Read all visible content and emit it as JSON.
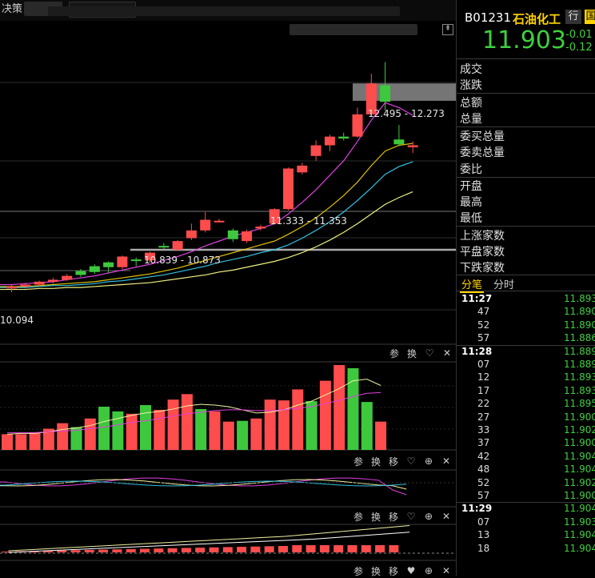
{
  "top": {
    "left_tab": "决策",
    "pin_icon": "pin-icon"
  },
  "main_chart": {
    "annotations": [
      {
        "text": "12.495 - 12.273"
      },
      {
        "text": "11.333 - 11.353"
      },
      {
        "text": "10.839 - 10.873"
      }
    ],
    "low_label": "10.094",
    "candles": [
      {
        "o": 10.18,
        "h": 10.22,
        "l": 10.14,
        "c": 10.2,
        "dir": "up"
      },
      {
        "o": 10.2,
        "h": 10.24,
        "l": 10.18,
        "c": 10.22,
        "dir": "up"
      },
      {
        "o": 10.22,
        "h": 10.26,
        "l": 10.2,
        "c": 10.25,
        "dir": "up"
      },
      {
        "o": 10.25,
        "h": 10.29,
        "l": 10.23,
        "c": 10.27,
        "dir": "up"
      },
      {
        "o": 10.27,
        "h": 10.33,
        "l": 10.26,
        "c": 10.31,
        "dir": "up"
      },
      {
        "o": 10.36,
        "h": 10.38,
        "l": 10.3,
        "c": 10.32,
        "dir": "down"
      },
      {
        "o": 10.41,
        "h": 10.43,
        "l": 10.33,
        "c": 10.35,
        "dir": "down"
      },
      {
        "o": 10.45,
        "h": 10.46,
        "l": 10.34,
        "c": 10.4,
        "dir": "down"
      },
      {
        "o": 10.4,
        "h": 10.52,
        "l": 10.38,
        "c": 10.51,
        "dir": "up"
      },
      {
        "o": 10.47,
        "h": 10.5,
        "l": 10.41,
        "c": 10.48,
        "dir": "down"
      },
      {
        "o": 10.47,
        "h": 10.56,
        "l": 10.45,
        "c": 10.55,
        "dir": "up"
      },
      {
        "o": 10.62,
        "h": 10.65,
        "l": 10.58,
        "c": 10.62,
        "dir": "down"
      },
      {
        "o": 10.58,
        "h": 10.68,
        "l": 10.57,
        "c": 10.67,
        "dir": "up"
      },
      {
        "o": 10.7,
        "h": 10.85,
        "l": 10.68,
        "c": 10.78,
        "dir": "up"
      },
      {
        "o": 10.78,
        "h": 10.97,
        "l": 10.76,
        "c": 10.89,
        "dir": "up"
      },
      {
        "o": 10.88,
        "h": 10.9,
        "l": 10.86,
        "c": 10.88,
        "dir": "up"
      },
      {
        "o": 10.78,
        "h": 10.8,
        "l": 10.66,
        "c": 10.69,
        "dir": "down"
      },
      {
        "o": 10.67,
        "h": 10.79,
        "l": 10.65,
        "c": 10.77,
        "dir": "up"
      },
      {
        "o": 10.8,
        "h": 10.84,
        "l": 10.78,
        "c": 10.82,
        "dir": "up"
      },
      {
        "o": 10.85,
        "h": 11.01,
        "l": 10.84,
        "c": 11.0,
        "dir": "up"
      },
      {
        "o": 11.0,
        "h": 11.43,
        "l": 10.99,
        "c": 11.42,
        "dir": "up"
      },
      {
        "o": 11.38,
        "h": 11.48,
        "l": 11.36,
        "c": 11.45,
        "dir": "up"
      },
      {
        "o": 11.55,
        "h": 11.71,
        "l": 11.5,
        "c": 11.66,
        "dir": "up"
      },
      {
        "o": 11.66,
        "h": 11.77,
        "l": 11.6,
        "c": 11.75,
        "dir": "up"
      },
      {
        "o": 11.75,
        "h": 11.79,
        "l": 11.71,
        "c": 11.73,
        "dir": "down"
      },
      {
        "o": 11.75,
        "h": 12.05,
        "l": 11.74,
        "c": 11.98,
        "dir": "up"
      },
      {
        "o": 11.98,
        "h": 12.4,
        "l": 11.96,
        "c": 12.3,
        "dir": "up"
      },
      {
        "o": 12.28,
        "h": 12.52,
        "l": 12.02,
        "c": 12.11,
        "dir": "down"
      },
      {
        "o": 11.72,
        "h": 11.87,
        "l": 11.65,
        "c": 11.67,
        "dir": "down"
      },
      {
        "o": 11.66,
        "h": 11.7,
        "l": 11.58,
        "c": 11.64,
        "dir": "up"
      }
    ],
    "ma_lines": [
      {
        "color": "#e040e0",
        "values": [
          10.22,
          10.23,
          10.24,
          10.25,
          10.27,
          10.29,
          10.31,
          10.34,
          10.37,
          10.4,
          10.43,
          10.47,
          10.51,
          10.56,
          10.62,
          10.67,
          10.72,
          10.76,
          10.8,
          10.85,
          10.95,
          11.07,
          11.2,
          11.35,
          11.5,
          11.7,
          11.92,
          12.1,
          12.05,
          11.97
        ]
      },
      {
        "color": "#e0c000",
        "values": [
          10.2,
          10.2,
          10.21,
          10.22,
          10.23,
          10.24,
          10.25,
          10.27,
          10.29,
          10.31,
          10.33,
          10.36,
          10.39,
          10.43,
          10.47,
          10.51,
          10.55,
          10.59,
          10.63,
          10.67,
          10.74,
          10.82,
          10.91,
          11.02,
          11.14,
          11.28,
          11.45,
          11.6,
          11.66,
          11.68
        ]
      },
      {
        "color": "#30c0e0",
        "values": [
          10.19,
          10.19,
          10.2,
          10.21,
          10.21,
          10.22,
          10.23,
          10.25,
          10.26,
          10.28,
          10.3,
          10.32,
          10.35,
          10.38,
          10.41,
          10.45,
          10.48,
          10.51,
          10.55,
          10.58,
          10.63,
          10.7,
          10.78,
          10.87,
          10.97,
          11.09,
          11.22,
          11.36,
          11.44,
          11.49
        ]
      },
      {
        "color": "#f0f080",
        "values": [
          10.17,
          10.17,
          10.18,
          10.18,
          10.19,
          10.19,
          10.2,
          10.21,
          10.22,
          10.23,
          10.24,
          10.26,
          10.28,
          10.3,
          10.32,
          10.35,
          10.37,
          10.4,
          10.43,
          10.46,
          10.5,
          10.55,
          10.61,
          10.68,
          10.76,
          10.85,
          10.95,
          11.05,
          11.12,
          11.18
        ]
      }
    ]
  },
  "tools1": [
    "参",
    "换",
    "♡",
    "✕"
  ],
  "tools2": [
    "参",
    "换",
    "移",
    "♡",
    "⊕",
    "✕"
  ],
  "tools3": [
    "参",
    "换",
    "移",
    "♡",
    "⊕",
    "✕"
  ],
  "tools4": [
    "参",
    "换",
    "移",
    "♥",
    "⊕",
    "✕"
  ],
  "volume": {
    "bars": [
      {
        "v": 20,
        "dir": "down"
      },
      {
        "v": 20,
        "dir": "down"
      },
      {
        "v": 22,
        "dir": "down"
      },
      {
        "v": 27,
        "dir": "down"
      },
      {
        "v": 34,
        "dir": "down"
      },
      {
        "v": 29,
        "dir": "up"
      },
      {
        "v": 40,
        "dir": "down"
      },
      {
        "v": 55,
        "dir": "up"
      },
      {
        "v": 49,
        "dir": "up"
      },
      {
        "v": 46,
        "dir": "down"
      },
      {
        "v": 57,
        "dir": "up"
      },
      {
        "v": 51,
        "dir": "down"
      },
      {
        "v": 64,
        "dir": "down"
      },
      {
        "v": 71,
        "dir": "down"
      },
      {
        "v": 52,
        "dir": "up"
      },
      {
        "v": 49,
        "dir": "down"
      },
      {
        "v": 36,
        "dir": "down"
      },
      {
        "v": 37,
        "dir": "up"
      },
      {
        "v": 40,
        "dir": "down"
      },
      {
        "v": 64,
        "dir": "down"
      },
      {
        "v": 63,
        "dir": "down"
      },
      {
        "v": 77,
        "dir": "down"
      },
      {
        "v": 62,
        "dir": "up"
      },
      {
        "v": 88,
        "dir": "down"
      },
      {
        "v": 108,
        "dir": "down"
      },
      {
        "v": 104,
        "dir": "up"
      },
      {
        "v": 61,
        "dir": "up"
      },
      {
        "v": 36,
        "dir": "down"
      }
    ]
  },
  "header": {
    "code": "B01231",
    "name": "石油化工",
    "tag_hang": "行",
    "tag_yellow": "国",
    "price": "11.903",
    "change1": "-0.01",
    "change2": "-0.12"
  },
  "fields": {
    "f1": "成交",
    "f2": "涨跌",
    "f3": "总额",
    "f4": "总量",
    "f5": "委买总量",
    "f6": "委卖总量",
    "f7": "委比",
    "f8": "开盘",
    "f9": "最高",
    "f10": "最低",
    "f11": "上涨家数",
    "f12": "平盘家数",
    "f13": "下跌家数"
  },
  "tabs": {
    "t1": "分笔",
    "t2": "分时"
  },
  "ticks": [
    {
      "time": "11:27",
      "price": "11.893",
      "major": true
    },
    {
      "time": "47",
      "price": "11.890",
      "major": false
    },
    {
      "time": "52",
      "price": "11.890",
      "major": false
    },
    {
      "time": "57",
      "price": "11.886",
      "major": false
    },
    {
      "time": "11:28",
      "price": "11.889",
      "major": true
    },
    {
      "time": "07",
      "price": "11.889",
      "major": false
    },
    {
      "time": "12",
      "price": "11.893",
      "major": false
    },
    {
      "time": "17",
      "price": "11.893",
      "major": false
    },
    {
      "time": "22",
      "price": "11.895",
      "major": false
    },
    {
      "time": "27",
      "price": "11.900",
      "major": false
    },
    {
      "time": "33",
      "price": "11.902",
      "major": false
    },
    {
      "time": "37",
      "price": "11.900",
      "major": false
    },
    {
      "time": "42",
      "price": "11.904",
      "major": false
    },
    {
      "time": "48",
      "price": "11.904",
      "major": false
    },
    {
      "time": "52",
      "price": "11.902",
      "major": false
    },
    {
      "time": "57",
      "price": "11.900",
      "major": false
    },
    {
      "time": "11:29",
      "price": "11.904",
      "major": true
    },
    {
      "time": "07",
      "price": "11.903",
      "major": false
    },
    {
      "time": "13",
      "price": "11.904",
      "major": false
    },
    {
      "time": "18",
      "price": "11.904",
      "major": false
    }
  ]
}
